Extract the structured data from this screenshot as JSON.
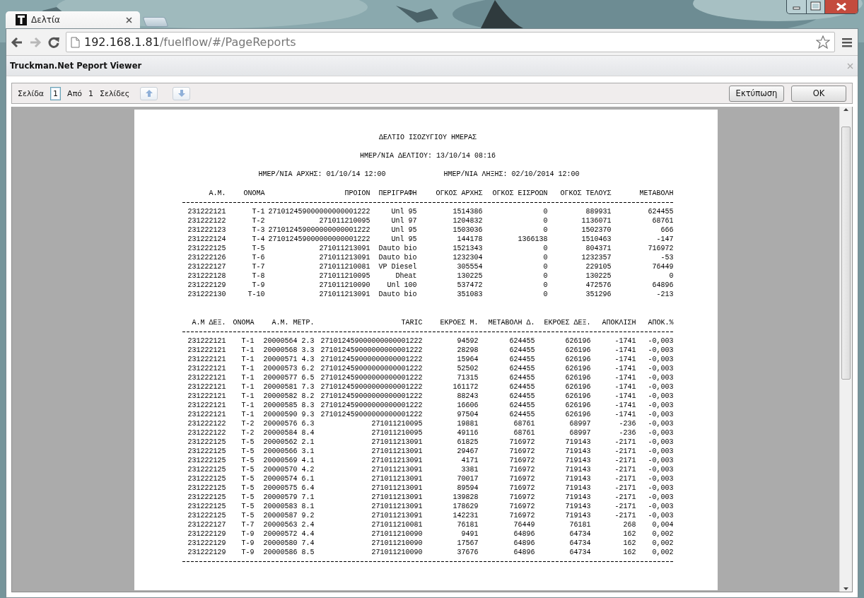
{
  "browser": {
    "tab_title": "Δελτία",
    "address_host": "192.168.1.81",
    "address_path": "/fuelflow/#/PageReports",
    "back_disabled": false,
    "forward_disabled": true
  },
  "dialog": {
    "title": "Truckman.Net Peport Viewer"
  },
  "pager": {
    "page_label": "Σελίδα",
    "page": "1",
    "of_label": "Από",
    "total": "1",
    "pages_label": "Σελίδες"
  },
  "buttons": [
    "Εκτύπωση",
    "OK"
  ],
  "report": {
    "title": "ΔΕΛΤΙΟ ΙΣΟΖΥΓΙΟΥ ΗΜΕΡΑΣ",
    "issued": "ΗΜΕΡ/ΝΙΑ ΔΕΛΤΙΟΥ: 13/10/14 08:16",
    "start": "ΗΜΕΡ/ΝΙΑ ΑΡΧΗΣ: 01/10/14 12:00",
    "end": "ΗΜΕΡ/ΝΙΑ ΛΗΞΗΣ: 02/10/2014 12:00",
    "tank_columns": [
      "Α.Μ.",
      "ΟΝΟΜΑ",
      "ΠΡΟΙΟΝ",
      "ΠΕΡΙΓΡΑΦΗ",
      "ΟΓΚΟΣ ΑΡΧΗΣ",
      "ΟΓΚΟΣ ΕΙΣΡΟΩΝ",
      "ΟΓΚΟΣ ΤΕΛΟΥΣ",
      "ΜΕΤΑΒΟΛΗ"
    ],
    "tank_rows": [
      [
        "231222121",
        "T-1",
        "271012459000000000001222",
        "Unl 95",
        "1514386",
        "0",
        "889931",
        "624455"
      ],
      [
        "231222122",
        "T-2",
        "271011210095",
        "Unl 97",
        "1204832",
        "0",
        "1136071",
        "68761"
      ],
      [
        "231222123",
        "T-3",
        "271012459000000000001222",
        "Unl 95",
        "1503036",
        "0",
        "1502370",
        "666"
      ],
      [
        "231222124",
        "T-4",
        "271012459000000000001222",
        "Unl 95",
        "144178",
        "1366138",
        "1510463",
        "-147"
      ],
      [
        "231222125",
        "T-5",
        "271011213091",
        "Dauto bio",
        "1521343",
        "0",
        "804371",
        "716972"
      ],
      [
        "231222126",
        "T-6",
        "271011213091",
        "Dauto bio",
        "1232304",
        "0",
        "1232357",
        "-53"
      ],
      [
        "231222127",
        "T-7",
        "271011210081",
        "VP Diesel",
        "305554",
        "0",
        "229105",
        "76449"
      ],
      [
        "231222128",
        "T-8",
        "271011210095",
        "Dheat",
        "130225",
        "0",
        "130225",
        "0"
      ],
      [
        "231222129",
        "T-9",
        "271011210090",
        "Unl 100",
        "537472",
        "0",
        "472576",
        "64896"
      ],
      [
        "231222130",
        "T-10",
        "271011213091",
        "Dauto bio",
        "351083",
        "0",
        "351296",
        "-213"
      ]
    ],
    "meter_columns": [
      "Α.Μ ΔΕΞ.",
      "ΟΝΟΜΑ",
      "Α.Μ. ΜΕΤΡ.",
      "TARIC",
      "ΕΚΡΟΕΣ Μ.",
      "ΜΕΤΑΒΟΛΗ Δ.",
      "ΕΚΡΟΕΣ ΔΕΞ.",
      "ΑΠΟΚΛΙΣΗ",
      "ΑΠΟΚ.%"
    ],
    "meter_rows": [
      [
        "231222121",
        "T-1",
        "20000564 2.3",
        "271012459000000000001222",
        "94592",
        "624455",
        "626196",
        "-1741",
        "-0,003"
      ],
      [
        "231222121",
        "T-1",
        "20000568 3.3",
        "271012459000000000001222",
        "28298",
        "624455",
        "626196",
        "-1741",
        "-0,003"
      ],
      [
        "231222121",
        "T-1",
        "20000571 4.3",
        "271012459000000000001222",
        "15964",
        "624455",
        "626196",
        "-1741",
        "-0,003"
      ],
      [
        "231222121",
        "T-1",
        "20000573 6.2",
        "271012459000000000001222",
        "52502",
        "624455",
        "626196",
        "-1741",
        "-0,003"
      ],
      [
        "231222121",
        "T-1",
        "20000577 6.5",
        "271012459000000000001222",
        "71315",
        "624455",
        "626196",
        "-1741",
        "-0,003"
      ],
      [
        "231222121",
        "T-1",
        "20000581 7.3",
        "271012459000000000001222",
        "161172",
        "624455",
        "626196",
        "-1741",
        "-0,003"
      ],
      [
        "231222121",
        "T-1",
        "20000582 8.2",
        "271012459000000000001222",
        "88243",
        "624455",
        "626196",
        "-1741",
        "-0,003"
      ],
      [
        "231222121",
        "T-1",
        "20000585 8.3",
        "271012459000000000001222",
        "16606",
        "624455",
        "626196",
        "-1741",
        "-0,003"
      ],
      [
        "231222121",
        "T-1",
        "20000590 9.3",
        "271012459000000000001222",
        "97504",
        "624455",
        "626196",
        "-1741",
        "-0,003"
      ],
      [
        "231222122",
        "T-2",
        "20000576 6.3",
        "271011210095",
        "19881",
        "68761",
        "68997",
        "-236",
        "-0,003"
      ],
      [
        "231222122",
        "T-2",
        "20000584 8.4",
        "271011210095",
        "49116",
        "68761",
        "68997",
        "-236",
        "-0,003"
      ],
      [
        "231222125",
        "T-5",
        "20000562 2.1",
        "271011213091",
        "61825",
        "716972",
        "719143",
        "-2171",
        "-0,003"
      ],
      [
        "231222125",
        "T-5",
        "20000566 3.1",
        "271011213091",
        "29467",
        "716972",
        "719143",
        "-2171",
        "-0,003"
      ],
      [
        "231222125",
        "T-5",
        "20000569 4.1",
        "271011213091",
        "4171",
        "716972",
        "719143",
        "-2171",
        "-0,003"
      ],
      [
        "231222125",
        "T-5",
        "20000570 4.2",
        "271011213091",
        "3381",
        "716972",
        "719143",
        "-2171",
        "-0,003"
      ],
      [
        "231222125",
        "T-5",
        "20000574 6.1",
        "271011213091",
        "70017",
        "716972",
        "719143",
        "-2171",
        "-0,003"
      ],
      [
        "231222125",
        "T-5",
        "20000575 6.4",
        "271011213091",
        "89594",
        "716972",
        "719143",
        "-2171",
        "-0,003"
      ],
      [
        "231222125",
        "T-5",
        "20000579 7.1",
        "271011213091",
        "139828",
        "716972",
        "719143",
        "-2171",
        "-0,003"
      ],
      [
        "231222125",
        "T-5",
        "20000583 8.1",
        "271011213091",
        "178629",
        "716972",
        "719143",
        "-2171",
        "-0,003"
      ],
      [
        "231222125",
        "T-5",
        "20000587 9.2",
        "271011213091",
        "142231",
        "716972",
        "719143",
        "-2171",
        "-0,003"
      ],
      [
        "231222127",
        "T-7",
        "20000563 2.4",
        "271011210081",
        "76181",
        "76449",
        "76181",
        "268",
        "0,004"
      ],
      [
        "231222129",
        "T-9",
        "20000572 4.4",
        "271011210090",
        "9491",
        "64896",
        "64734",
        "162",
        "0,002"
      ],
      [
        "231222129",
        "T-9",
        "20000580 7.4",
        "271011210090",
        "17567",
        "64896",
        "64734",
        "162",
        "0,002"
      ],
      [
        "231222129",
        "T-9",
        "20000586 8.5",
        "271011210090",
        "37676",
        "64896",
        "64734",
        "162",
        "0,002"
      ]
    ]
  }
}
